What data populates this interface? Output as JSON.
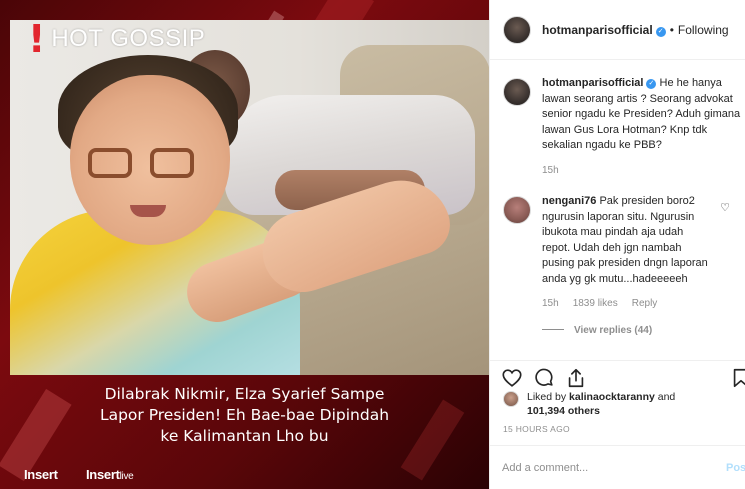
{
  "media": {
    "badge_mark": "!",
    "badge_text": "HOT GOSSIP",
    "caption_lines": [
      "Dilabrak Nikmir,  Elza Syarief Sampe",
      "Lapor Presiden!  Eh Bae-bae Dipindah",
      "ke Kalimantan Lho bu"
    ],
    "logo_left": "Insert",
    "logo_right_main": "Insert",
    "logo_right_sub": "live"
  },
  "header": {
    "username": "hotmanparisofficial",
    "verified_mark": "✓",
    "separator": "•",
    "follow_label": "Following"
  },
  "comments": [
    {
      "username": "hotmanparisofficial",
      "text": "He he hanya lawan seorang artis ? Seorang advokat senior ngadu ke Presiden? Aduh gimana lawan Gus Lora Hotman? Knp tdk sekalian ngadu ke PBB?",
      "time": "15h"
    },
    {
      "username": "nengani76",
      "text": "Pak presiden boro2 ngurusin laporan situ. Ngurusin ibukota mau pindah aja udah repot. Udah deh jgn nambah pusing pak presiden dngn laporan anda yg gk mutu...hadeeeeeh",
      "time": "15h",
      "likes": "1839 likes",
      "reply_label": "Reply",
      "view_replies": "View replies (44)"
    }
  ],
  "likes": {
    "prefix": "Liked by ",
    "user": "kalinaocktaranny",
    "middle": " and ",
    "count": "101,394 others"
  },
  "timestamp": "15 HOURS AGO",
  "add_comment": {
    "placeholder": "Add a comment...",
    "post_label": "Post"
  },
  "colors": {
    "accent_blue": "#3897f0",
    "post_disabled": "#b2dffc",
    "brand_red": "#e2262e",
    "muted_text": "#8e8e8e"
  },
  "icons": [
    "heart-icon",
    "comment-icon",
    "share-icon",
    "bookmark-icon"
  ]
}
